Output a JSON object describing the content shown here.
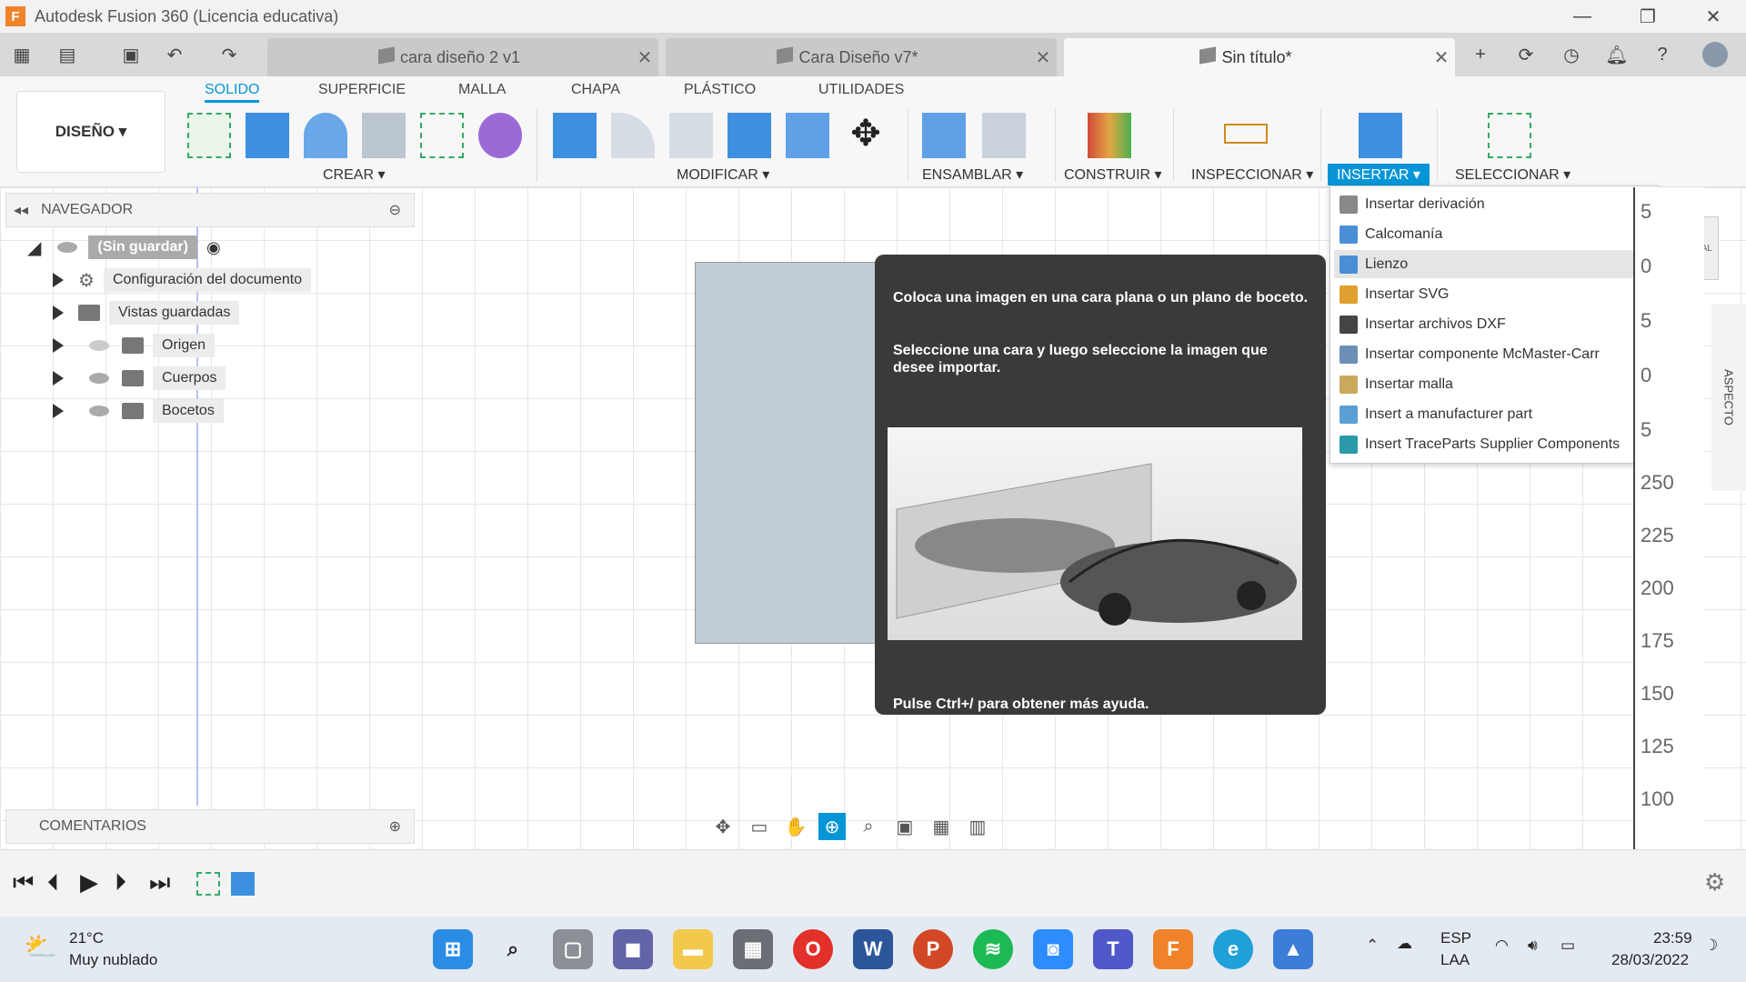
{
  "window": {
    "title": "Autodesk Fusion 360 (Licencia educativa)",
    "app_letter": "F"
  },
  "tabs": [
    {
      "label": "cara diseño 2 v1"
    },
    {
      "label": "Cara Diseño v7*"
    },
    {
      "label": "Sin título*"
    }
  ],
  "workspace_tabs": [
    "SOLIDO",
    "SUPERFICIE",
    "MALLA",
    "CHAPA",
    "PLÁSTICO",
    "UTILIDADES"
  ],
  "design_button": "DISEÑO ▾",
  "toolbar_groups": [
    "CREAR ▾",
    "MODIFICAR ▾",
    "ENSAMBLAR ▾",
    "CONSTRUIR ▾",
    "INSPECCIONAR ▾",
    "INSERTAR ▾",
    "SELECCIONAR ▾"
  ],
  "navigator": {
    "title": "NAVEGADOR",
    "root": "(Sin guardar)",
    "items": [
      "Configuración del documento",
      "Vistas guardadas",
      "Origen",
      "Cuerpos",
      "Bocetos"
    ]
  },
  "tooltip": {
    "line1": "Coloca una imagen en una cara plana o un plano de boceto.",
    "line2": "Seleccione una cara y luego seleccione la imagen que desee importar.",
    "help": "Pulse Ctrl+/ para obtener más ayuda."
  },
  "insert_menu": [
    "Insertar derivación",
    "Calcomanía",
    "Lienzo",
    "Insertar SVG",
    "Insertar archivos DXF",
    "Insertar componente McMaster-Carr",
    "Insertar malla",
    "Insert a manufacturer part",
    "Insert TraceParts Supplier Components"
  ],
  "ruler_numbers": [
    "5",
    "0",
    "5",
    "0",
    "5",
    "250",
    "225",
    "200",
    "175",
    "150",
    "125",
    "100"
  ],
  "viewcube_label": "FRONTAL",
  "aspect_label": "ASPECTO",
  "comments_label": "COMENTARIOS",
  "taskbar": {
    "weather_temp": "21°C",
    "weather_desc": "Muy nublado",
    "lang1": "ESP",
    "lang2": "LAA",
    "time": "23:59",
    "date": "28/03/2022"
  },
  "colors": {
    "accent": "#0696d7",
    "fusion_orange": "#f0832a",
    "tooltip_bg": "#3a3a3a"
  }
}
